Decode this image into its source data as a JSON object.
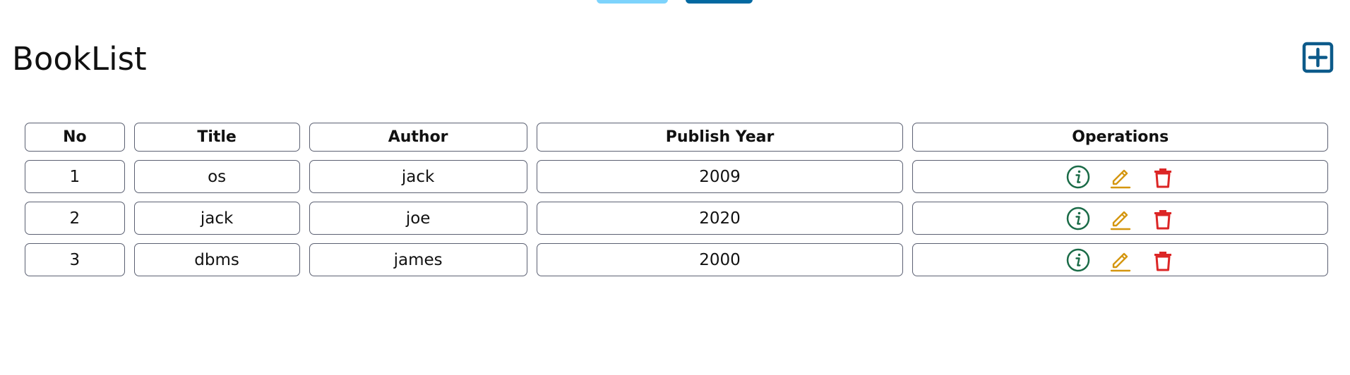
{
  "page": {
    "title": "BookList"
  },
  "colors": {
    "add_button": "#0c5a8a",
    "info_icon": "#1a6b47",
    "edit_icon": "#d4960f",
    "delete_icon": "#dc2626",
    "top_button_light": "#7dd3fc",
    "top_button_dark": "#0369a1"
  },
  "table": {
    "headers": {
      "no": "No",
      "title": "Title",
      "author": "Author",
      "year": "Publish Year",
      "operations": "Operations"
    },
    "rows": [
      {
        "no": "1",
        "title": "os",
        "author": "jack",
        "year": "2009"
      },
      {
        "no": "2",
        "title": "jack",
        "author": "joe",
        "year": "2020"
      },
      {
        "no": "3",
        "title": "dbms",
        "author": "james",
        "year": "2000"
      }
    ],
    "row_icons": [
      "info-icon",
      "edit-icon",
      "delete-icon"
    ]
  },
  "icons": {
    "add": "plus-square-icon"
  }
}
